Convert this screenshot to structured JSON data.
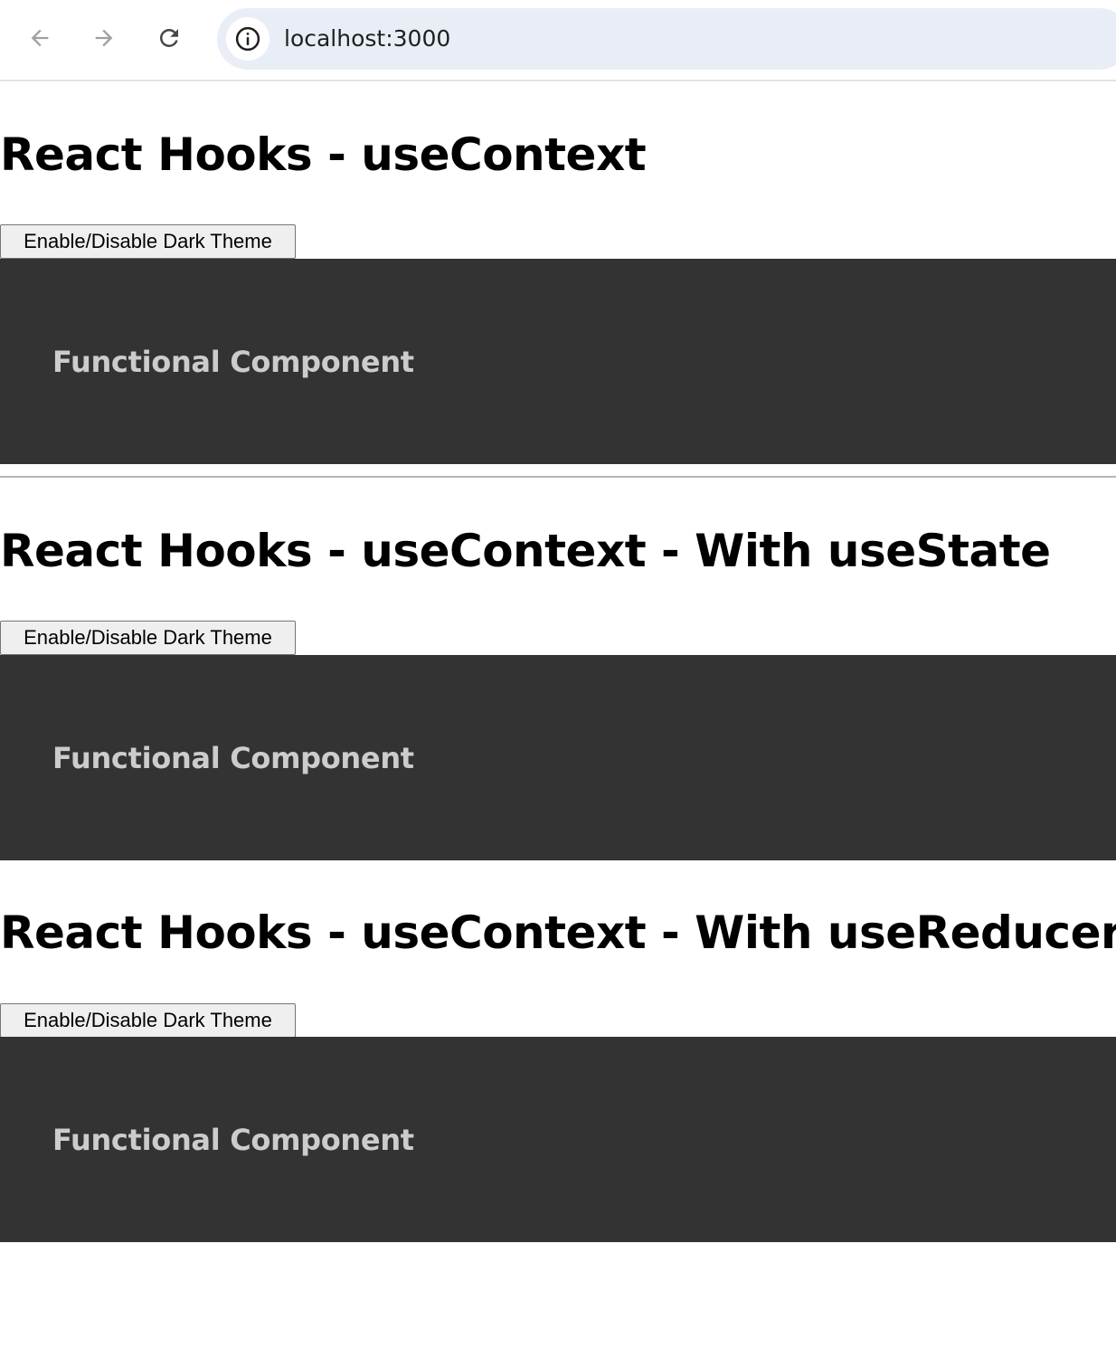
{
  "browser": {
    "url": "localhost:3000",
    "icons": {
      "back": "arrow-left-icon",
      "forward": "arrow-right-icon",
      "reload": "reload-icon",
      "site_info": "info-icon"
    }
  },
  "sections": [
    {
      "title": "React Hooks - useContext",
      "button_label": "Enable/Disable Dark Theme",
      "panel_text": "Functional Component"
    },
    {
      "title": "React Hooks - useContext - With useState",
      "button_label": "Enable/Disable Dark Theme",
      "panel_text": "Functional Component"
    },
    {
      "title": "React Hooks - useContext - With useReducer",
      "button_label": "Enable/Disable Dark Theme",
      "panel_text": "Functional Component"
    }
  ],
  "colors": {
    "panel_background": "#333333",
    "panel_text": "#cccccc",
    "address_bar": "#e9eef6"
  }
}
